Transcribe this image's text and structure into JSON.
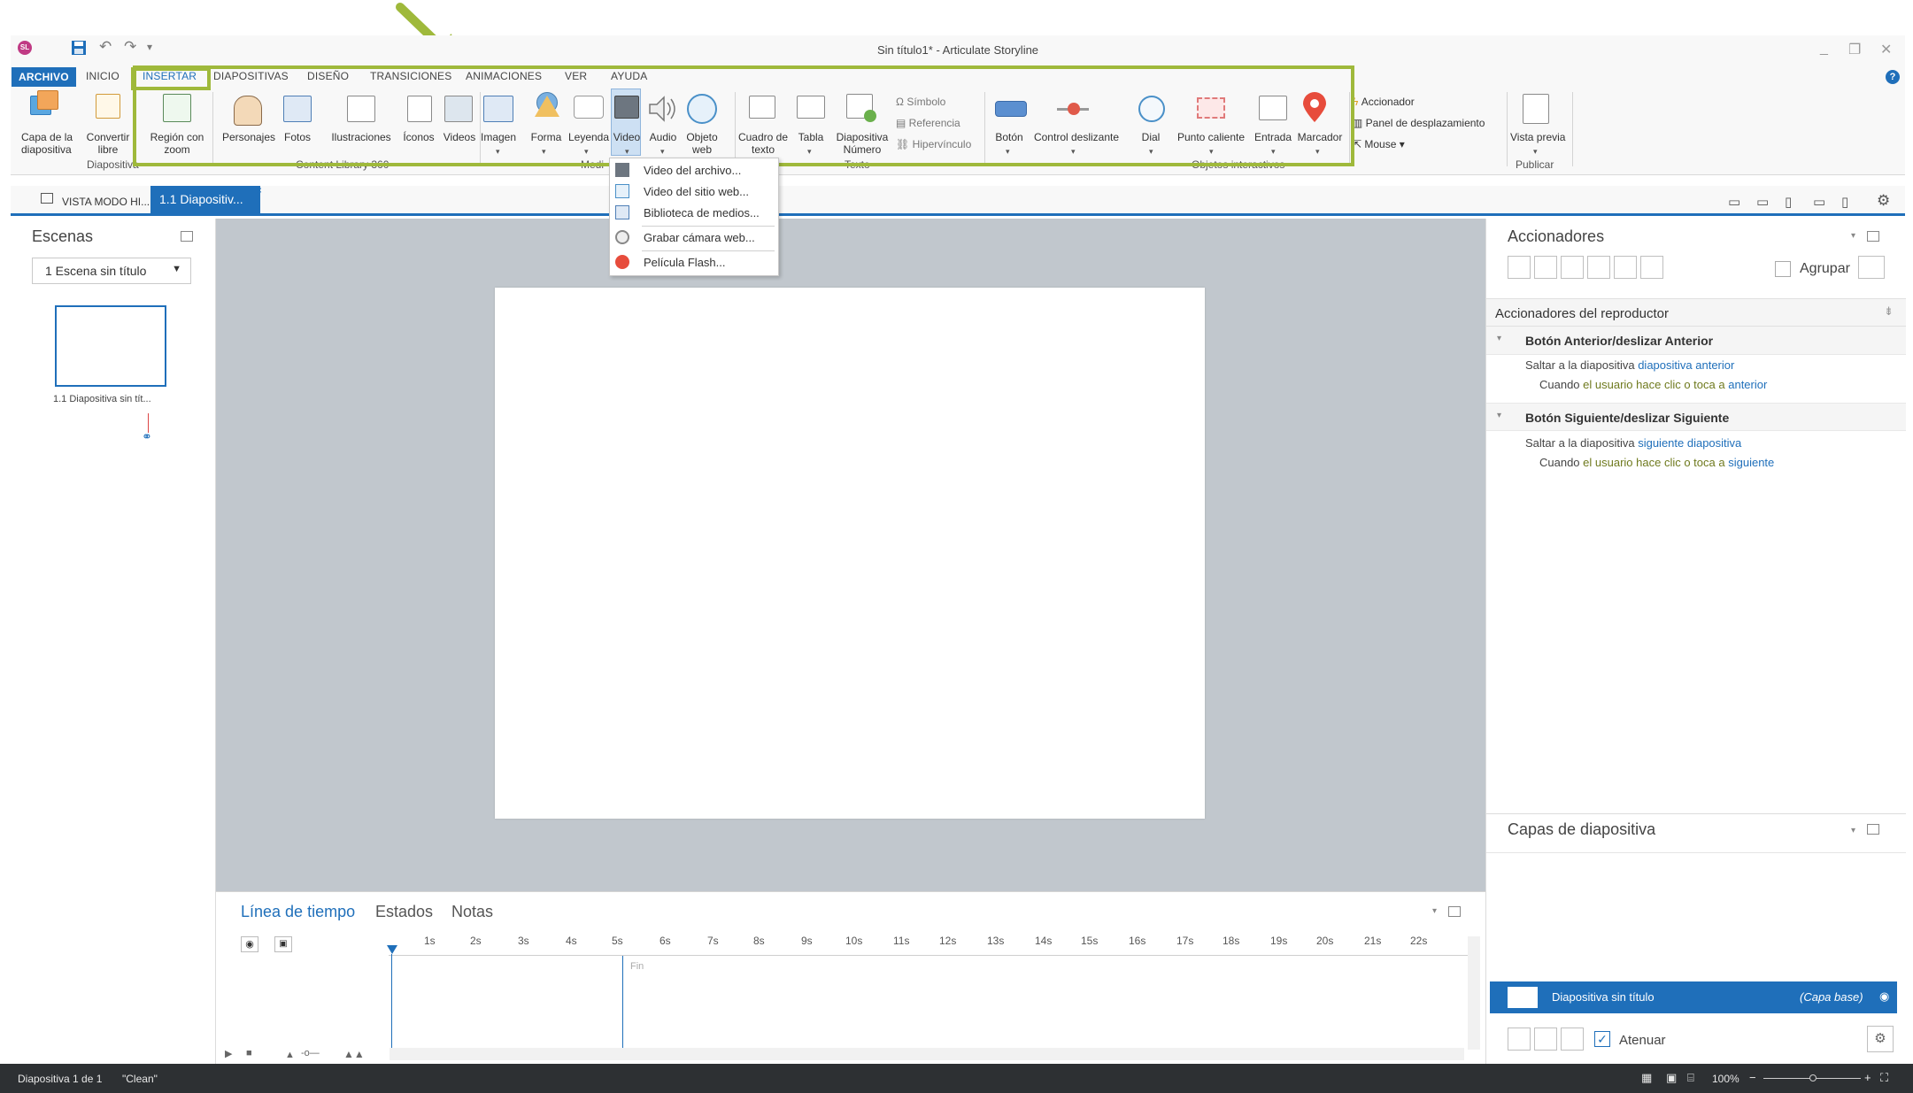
{
  "window": {
    "title": "Sin título1* - Articulate Storyline",
    "logo_text": "SL"
  },
  "menu": {
    "file": "ARCHIVO",
    "tabs": [
      "INICIO",
      "INSERTAR",
      "DIAPOSITIVAS",
      "DISEÑO",
      "TRANSICIONES",
      "ANIMACIONES",
      "VER",
      "AYUDA"
    ],
    "help": "?"
  },
  "ribbon": {
    "capa": [
      "Capa de la",
      "diapositiva"
    ],
    "convertir": [
      "Convertir",
      "libre"
    ],
    "zoom": [
      "Región con",
      "zoom"
    ],
    "group_diapositiva": "Diapositiva",
    "personajes": "Personajes",
    "fotos": "Fotos",
    "ilustraciones": "Ilustraciones",
    "iconos": "Íconos",
    "videos": "Videos",
    "group_content": "Content Library 360",
    "imagen": "Imagen",
    "forma": "Forma",
    "leyenda": "Leyenda",
    "video": "Video",
    "audio": "Audio",
    "objeto": [
      "Objeto",
      "web"
    ],
    "group_media": "Medi",
    "cuadro": [
      "Cuadro de",
      "texto"
    ],
    "tabla": "Tabla",
    "diapositiva_num": [
      "Diapositiva",
      "Número"
    ],
    "simbolo": "Símbolo",
    "referencia": "Referencia",
    "hipervinculo": "Hipervínculo",
    "group_texto": "Texto",
    "boton": "Botón",
    "control": "Control deslizante",
    "dial": "Dial",
    "punto": "Punto caliente",
    "entrada": "Entrada",
    "marcador": "Marcador",
    "group_objetos": "Objetos interactivos",
    "accionador": "Accionador",
    "panel": "Panel de desplazamiento",
    "mouse": "Mouse",
    "vista_previa": "Vista previa",
    "group_publicar": "Publicar"
  },
  "video_menu": [
    "Video del archivo...",
    "Video del sitio web...",
    "Biblioteca de medios...",
    "Grabar cámara web...",
    "Película Flash..."
  ],
  "doc_tabs": {
    "story_view": "VISTA MODO HI...",
    "slide_tab": "1.1 Diapositiv...",
    "close": "×"
  },
  "scenes": {
    "title": "Escenas",
    "dropdown": "1 Escena sin título",
    "slide_label": "1.1 Diapositiva sin tít..."
  },
  "timeline": {
    "tabs": [
      "Línea de tiempo",
      "Estados",
      "Notas"
    ],
    "ticks": [
      "1s",
      "2s",
      "3s",
      "4s",
      "5s",
      "6s",
      "7s",
      "8s",
      "9s",
      "10s",
      "11s",
      "12s",
      "13s",
      "14s",
      "15s",
      "16s",
      "17s",
      "18s",
      "19s",
      "20s",
      "21s",
      "22s"
    ],
    "end_label": "Fin"
  },
  "triggers": {
    "title": "Accionadores",
    "group_label": "Agrupar",
    "player_header": "Accionadores del reproductor",
    "items": [
      {
        "header": "Botón Anterior/deslizar Anterior",
        "action_prefix": "Saltar a la diapositiva",
        "action_target": "diapositiva anterior",
        "when_prefix": "Cuando",
        "when_condition": "el usuario hace clic o toca a",
        "when_object": "anterior"
      },
      {
        "header": "Botón Siguiente/deslizar Siguiente",
        "action_prefix": "Saltar a la diapositiva",
        "action_target": "siguiente diapositiva",
        "when_prefix": "Cuando",
        "when_condition": "el usuario hace clic o toca a",
        "when_object": "siguiente"
      }
    ]
  },
  "layers": {
    "title": "Capas de diapositiva",
    "base_name": "Diapositiva sin título",
    "base_tag": "(Capa base)",
    "dim_label": "Atenuar"
  },
  "status": {
    "slide": "Diapositiva 1 de 1",
    "theme": "\"Clean\"",
    "zoom": "100%"
  },
  "colors": {
    "accent": "#1f6fba",
    "highlight": "#9fb93b",
    "stage": "#c1c7cd",
    "statusbar": "#2d3033"
  }
}
